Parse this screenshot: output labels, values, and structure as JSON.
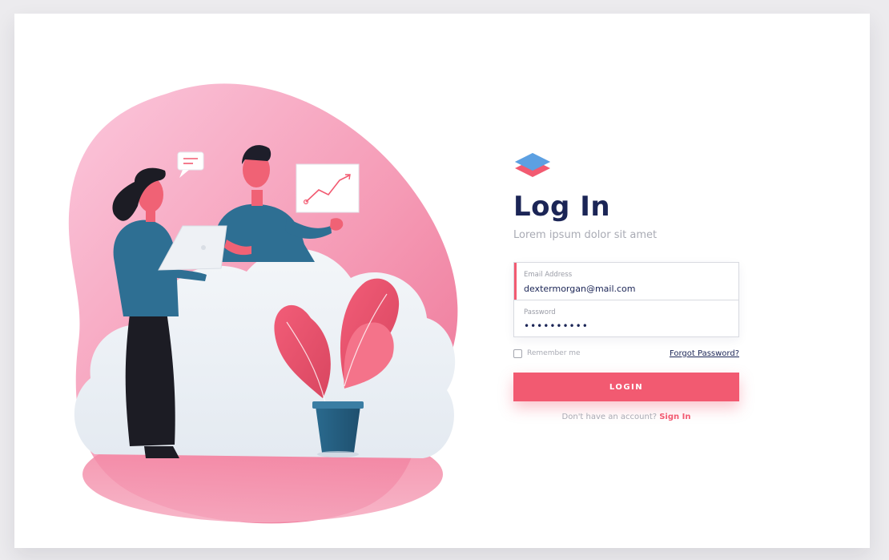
{
  "login": {
    "title": "Log In",
    "subtitle": "Lorem ipsum dolor sit amet",
    "email": {
      "label": "Email Address",
      "value": "dextermorgan@mail.com"
    },
    "password": {
      "label": "Password",
      "value": "••••••••••"
    },
    "remember_label": "Remember me",
    "forgot_label": "Forgot Password?",
    "button_label": "LOGIN",
    "signup_prompt": "Don't have an account?",
    "signup_link": "Sign In"
  },
  "icons": {
    "logo": "stacked-layers-logo",
    "checkbox": "checkbox-unchecked"
  },
  "colors": {
    "accent": "#f25a71",
    "heading": "#1b2556",
    "muted": "#a9abb4",
    "blob_pink": "#f59cb6",
    "cloud": "#e9eef4",
    "shirt_blue": "#2e6f93"
  }
}
